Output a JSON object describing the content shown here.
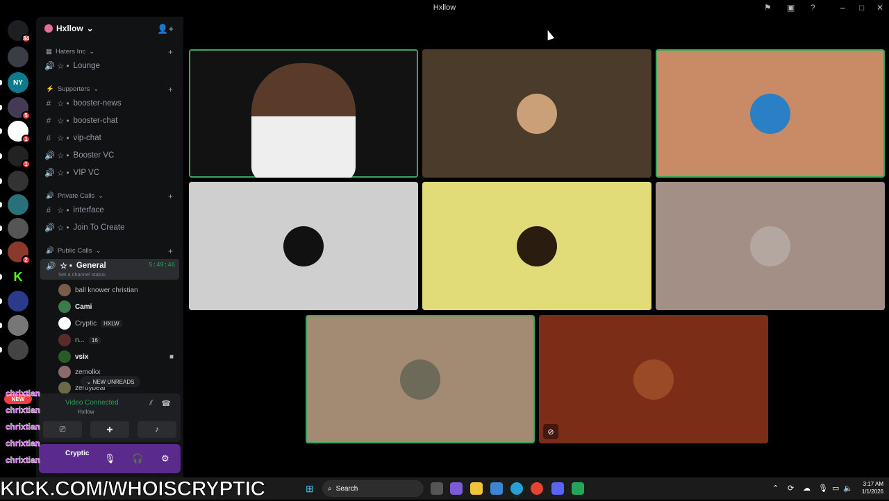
{
  "window": {
    "title": "Hxllow"
  },
  "rail": {
    "servers": [
      {
        "name": "discord-home",
        "badge": "34",
        "color": "#1e1f22"
      },
      {
        "name": "server-2",
        "badge": "",
        "color": "#3a3d44"
      },
      {
        "name": "server-ny",
        "badge": "",
        "color": "#0e7a8c",
        "label": "NY"
      },
      {
        "name": "server-4",
        "badge": "5",
        "color": "#443a55"
      },
      {
        "name": "server-5",
        "badge": "1",
        "color": "#ffffff"
      },
      {
        "name": "server-6",
        "badge": "1",
        "color": "#222"
      },
      {
        "name": "server-7",
        "badge": "",
        "color": "#333"
      },
      {
        "name": "server-8",
        "badge": "",
        "color": "#2a6f7a"
      },
      {
        "name": "server-9",
        "badge": "",
        "color": "#555"
      },
      {
        "name": "server-10",
        "badge": "2",
        "color": "#8a3a2a"
      },
      {
        "name": "server-kick",
        "badge": "",
        "color": "#000",
        "label": "K"
      },
      {
        "name": "server-12",
        "badge": "",
        "color": "#2b3a8a"
      },
      {
        "name": "server-13",
        "badge": "",
        "color": "#777"
      },
      {
        "name": "server-14",
        "badge": "",
        "color": "#444"
      }
    ],
    "new_label": "NEW"
  },
  "sidebar": {
    "guild_name": "Hxllow",
    "categories": [
      {
        "label": "Haters Inc",
        "channels": [
          {
            "icon": "speaker",
            "name": "Lounge"
          }
        ]
      },
      {
        "label": "Supporters",
        "channels": [
          {
            "icon": "hash",
            "name": "booster-news"
          },
          {
            "icon": "hash",
            "name": "booster-chat"
          },
          {
            "icon": "hash",
            "name": "vip-chat"
          },
          {
            "icon": "speaker",
            "name": "Booster VC"
          },
          {
            "icon": "speaker",
            "name": "VIP VC"
          }
        ]
      },
      {
        "label": "Private Calls",
        "channels": [
          {
            "icon": "hash",
            "name": "interface"
          },
          {
            "icon": "speaker",
            "name": "Join To Create"
          }
        ]
      },
      {
        "label": "Public Calls",
        "channels": []
      }
    ],
    "active_channel": {
      "name": "General",
      "time": "5:49:46",
      "status": "Set a channel status"
    },
    "voice_users": [
      {
        "name": "ball knower christian",
        "tag": ""
      },
      {
        "name": "Cami",
        "tag": ""
      },
      {
        "name": "Cryptic",
        "tag": "HXLW"
      },
      {
        "name": "n...",
        "tag": "16"
      },
      {
        "name": "vsix",
        "tag": ""
      },
      {
        "name": "zemolkx",
        "tag": ""
      },
      {
        "name": "zeroybear",
        "tag": ""
      }
    ],
    "new_unreads": "NEW UNREADS",
    "voice_panel": {
      "status": "Video Connected",
      "sub": "Hxllow"
    },
    "user_panel": {
      "name": "Cryptic"
    }
  },
  "chat_overlay": [
    "chrixtian",
    "chrixtian",
    "chrixtian",
    "chrixtian",
    "chrixtian"
  ],
  "tiles": [
    {
      "bg": "#121212",
      "speaking": true,
      "camera": true,
      "avatar": ""
    },
    {
      "bg": "#4b3b2a",
      "speaking": false,
      "avatar": "#c9a078"
    },
    {
      "bg": "#c98a66",
      "speaking": true,
      "avatar": "#2b7fc4"
    },
    {
      "bg": "#cfcfcf",
      "speaking": false,
      "avatar": "#111111"
    },
    {
      "bg": "#e2dc78",
      "speaking": false,
      "avatar": "#2a1d0f"
    },
    {
      "bg": "#a38f86",
      "speaking": false,
      "avatar": "#b3a7a0"
    },
    {
      "bg": "#a38a73",
      "speaking": true,
      "avatar": "#6e6a5a"
    },
    {
      "bg": "#7c2d18",
      "speaking": false,
      "avatar": "#9b4a26",
      "hidden_icon": true
    }
  ],
  "taskbar": {
    "banner": "KICK.COM/WHOISCRYPTIC",
    "search_label": "Search",
    "time": "3:17 AM",
    "date": "1/1/2026"
  }
}
